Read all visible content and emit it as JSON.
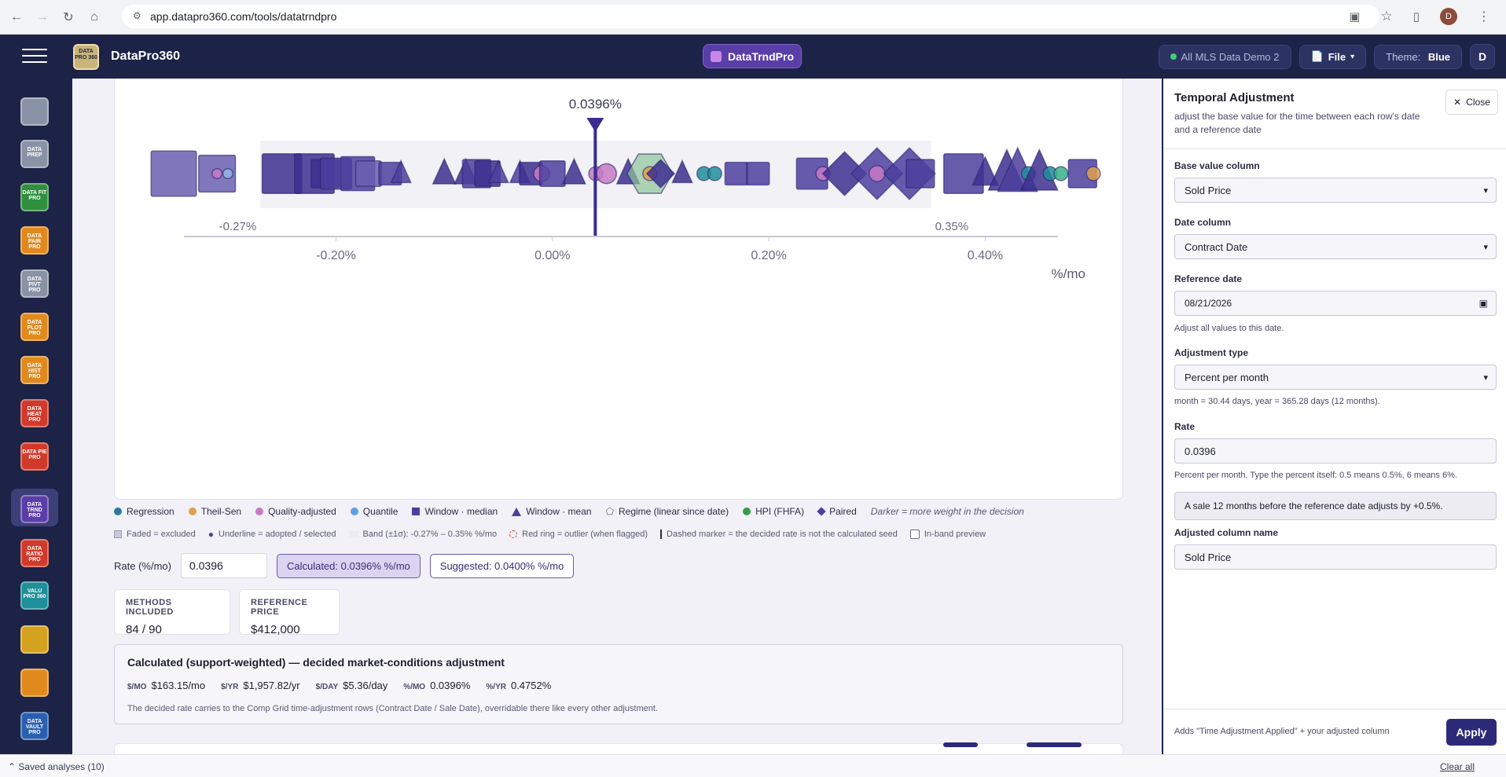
{
  "browser": {
    "url": "app.datapro360.com/tools/datatrndpro",
    "avatar_letter": "D"
  },
  "app": {
    "brand": "DataPro360",
    "logo_text": "DATA PRO 360",
    "tool_name": "DataTrndPro",
    "data_source": "All MLS Data Demo 2",
    "file_label": "File",
    "theme_label": "Theme: ",
    "theme_value": "Blue",
    "user_badge": "D"
  },
  "sidebar": {
    "items": [
      {
        "label": "",
        "color": "#8a93a6"
      },
      {
        "label": "DATA PREP",
        "color": "#8a93a6"
      },
      {
        "label": "DATA FIT PRO",
        "color": "#2f8f3f"
      },
      {
        "label": "DATA PAIR PRO",
        "color": "#e08a1e"
      },
      {
        "label": "DATA PIVT PRO",
        "color": "#8a93a6"
      },
      {
        "label": "DATA PLOT PRO",
        "color": "#e08a1e"
      },
      {
        "label": "DATA HIST PRO",
        "color": "#e08a1e"
      },
      {
        "label": "DATA HEAT PRO",
        "color": "#d13a2a"
      },
      {
        "label": "DATA PIE PRO",
        "color": "#d13a2a"
      },
      {
        "label": "DATA TRND PRO",
        "color": "#5a3ea8"
      },
      {
        "label": "DATA RATIO PRO",
        "color": "#d13a2a"
      },
      {
        "label": "VALU PRO 360",
        "color": "#1f8f9a"
      },
      {
        "label": "",
        "color": "#d4a21e"
      },
      {
        "label": "",
        "color": "#e08a1e"
      },
      {
        "label": "DATA VAULT PRO",
        "color": "#2a5fb0"
      }
    ]
  },
  "chart_data": {
    "type": "scatter",
    "xlabel": "%/mo",
    "xlim": [
      -0.39,
      0.46
    ],
    "ticks": [
      "-0.20%",
      "0.00%",
      "0.20%",
      "0.40%"
    ],
    "tick_values": [
      -0.2,
      0.0,
      0.2,
      0.4
    ],
    "decided_rate": 0.0396,
    "decided_label": "0.0396%",
    "band_low": -0.27,
    "band_high": 0.35,
    "band_low_label": "-0.27%",
    "band_high_label": "0.35%",
    "points": [
      {
        "x": -0.35,
        "shape": "square",
        "s": 1.6,
        "c": "#6a5fb0"
      },
      {
        "x": -0.31,
        "shape": "square",
        "s": 1.3,
        "c": "#6a5fb0"
      },
      {
        "x": -0.3,
        "shape": "circle",
        "s": 0.5,
        "c": "#8fb5e0"
      },
      {
        "x": -0.31,
        "shape": "circle",
        "s": 0.5,
        "c": "#c77ac4"
      },
      {
        "x": -0.25,
        "shape": "square",
        "s": 1.4,
        "c": "#3d2f8f"
      },
      {
        "x": -0.22,
        "shape": "square",
        "s": 1.4,
        "c": "#3d2f8f"
      },
      {
        "x": -0.21,
        "shape": "square",
        "s": 1.0,
        "c": "#3d2f8f"
      },
      {
        "x": -0.2,
        "shape": "square",
        "s": 1.1,
        "c": "#4c3f9e"
      },
      {
        "x": -0.18,
        "shape": "square",
        "s": 1.2,
        "c": "#4c3f9e"
      },
      {
        "x": -0.17,
        "shape": "square",
        "s": 0.9,
        "c": "#6a5fb0"
      },
      {
        "x": -0.15,
        "shape": "square",
        "s": 0.8,
        "c": "#4c3f9e"
      },
      {
        "x": -0.14,
        "shape": "triangle",
        "s": 0.7,
        "c": "#4c3f9e"
      },
      {
        "x": -0.1,
        "shape": "triangle",
        "s": 0.8,
        "c": "#3d2f8f"
      },
      {
        "x": -0.08,
        "shape": "triangle",
        "s": 0.8,
        "c": "#3d2f8f"
      },
      {
        "x": -0.07,
        "shape": "square",
        "s": 1.0,
        "c": "#4c3f9e"
      },
      {
        "x": -0.06,
        "shape": "square",
        "s": 0.9,
        "c": "#3d2f8f"
      },
      {
        "x": -0.05,
        "shape": "triangle",
        "s": 0.7,
        "c": "#4c3f9e"
      },
      {
        "x": -0.03,
        "shape": "triangle",
        "s": 0.7,
        "c": "#4c3f9e"
      },
      {
        "x": -0.02,
        "shape": "square",
        "s": 0.8,
        "c": "#3d2f8f"
      },
      {
        "x": -0.01,
        "shape": "circle",
        "s": 0.8,
        "c": "#c77ac4"
      },
      {
        "x": 0.0,
        "shape": "square",
        "s": 0.9,
        "c": "#4c3f9e"
      },
      {
        "x": 0.02,
        "shape": "triangle",
        "s": 0.8,
        "c": "#3d2f8f"
      },
      {
        "x": 0.04,
        "shape": "circle",
        "s": 0.7,
        "c": "#c77ac4"
      },
      {
        "x": 0.05,
        "shape": "circle",
        "s": 1.0,
        "c": "#c77ac4"
      },
      {
        "x": 0.07,
        "shape": "triangle",
        "s": 0.8,
        "c": "#3d2f8f"
      },
      {
        "x": 0.09,
        "shape": "hexagon",
        "s": 1.6,
        "c": "#8fc49a"
      },
      {
        "x": 0.09,
        "shape": "circle",
        "s": 0.7,
        "c": "#e0a050"
      },
      {
        "x": 0.1,
        "shape": "diamond",
        "s": 0.7,
        "c": "#3d2f8f"
      },
      {
        "x": 0.12,
        "shape": "triangle",
        "s": 0.7,
        "c": "#3d2f8f"
      },
      {
        "x": 0.14,
        "shape": "circle",
        "s": 0.7,
        "c": "#1f8f9a"
      },
      {
        "x": 0.15,
        "shape": "circle",
        "s": 0.7,
        "c": "#1f8f9a"
      },
      {
        "x": 0.17,
        "shape": "square",
        "s": 0.8,
        "c": "#4c3f9e"
      },
      {
        "x": 0.19,
        "shape": "square",
        "s": 0.8,
        "c": "#4c3f9e"
      },
      {
        "x": 0.24,
        "shape": "square",
        "s": 1.1,
        "c": "#4c3f9e"
      },
      {
        "x": 0.25,
        "shape": "circle",
        "s": 0.7,
        "c": "#c77ac4"
      },
      {
        "x": 0.27,
        "shape": "diamond",
        "s": 1.1,
        "c": "#3d2f8f"
      },
      {
        "x": 0.3,
        "shape": "diamond",
        "s": 1.3,
        "c": "#4c3f9e"
      },
      {
        "x": 0.3,
        "shape": "circle",
        "s": 0.8,
        "c": "#c77ac4"
      },
      {
        "x": 0.33,
        "shape": "diamond",
        "s": 1.3,
        "c": "#4c3f9e"
      },
      {
        "x": 0.34,
        "shape": "square",
        "s": 1.0,
        "c": "#4c3f9e"
      },
      {
        "x": 0.38,
        "shape": "square",
        "s": 1.4,
        "c": "#4c3f9e"
      },
      {
        "x": 0.4,
        "shape": "triangle",
        "s": 0.9,
        "c": "#3d2f8f"
      },
      {
        "x": 0.42,
        "shape": "triangle",
        "s": 1.3,
        "c": "#3d2f8f"
      },
      {
        "x": 0.43,
        "shape": "triangle",
        "s": 1.4,
        "c": "#4c3f9e"
      },
      {
        "x": 0.44,
        "shape": "circle",
        "s": 0.7,
        "c": "#1f8f9a"
      },
      {
        "x": 0.45,
        "shape": "triangle",
        "s": 1.3,
        "c": "#3d2f8f"
      },
      {
        "x": 0.46,
        "shape": "circle",
        "s": 0.7,
        "c": "#1f8f9a"
      },
      {
        "x": 0.47,
        "shape": "circle",
        "s": 0.7,
        "c": "#3ab08a"
      },
      {
        "x": 0.49,
        "shape": "square",
        "s": 1.0,
        "c": "#4c3f9e"
      },
      {
        "x": 0.5,
        "shape": "circle",
        "s": 0.7,
        "c": "#e0a050"
      },
      {
        "x": 0.57,
        "shape": "triangle",
        "s": 1.6,
        "c": "#6a5fb0"
      }
    ]
  },
  "legend": {
    "items": [
      {
        "label": "Regression",
        "color": "#2a7a9a",
        "shape": "circle"
      },
      {
        "label": "Theil-Sen",
        "color": "#e0a050",
        "shape": "circle"
      },
      {
        "label": "Quality-adjusted",
        "color": "#c77ac4",
        "shape": "circle"
      },
      {
        "label": "Quantile",
        "color": "#5aa0e0",
        "shape": "circle"
      },
      {
        "label": "Window · median",
        "color": "#4c3f9e",
        "shape": "square"
      },
      {
        "label": "Window · mean",
        "color": "#4c3f9e",
        "shape": "triangle"
      },
      {
        "label": "Regime (linear since date)",
        "color": "#6a6a80",
        "shape": "pentagon"
      },
      {
        "label": "HPI (FHFA)",
        "color": "#3a9a4a",
        "shape": "circle"
      },
      {
        "label": "Paired",
        "color": "#4c3f9e",
        "shape": "diamond"
      }
    ],
    "note": "Darker = more weight in the decision",
    "row2": {
      "faded": "Faded = excluded",
      "underline": "Underline = adopted / selected",
      "band": "Band (±1σ): -0.27% – 0.35% %/mo",
      "red_ring": "Red ring = outlier (when flagged)",
      "dashed": "Dashed marker = the decided rate is not the calculated seed",
      "inband": "In-band preview"
    }
  },
  "rate": {
    "label": "Rate (%/mo)",
    "value": "0.0396",
    "calculated": "Calculated: 0.0396% %/mo",
    "suggested": "Suggested: 0.0400% %/mo"
  },
  "stats": {
    "methods_label": "METHODS INCLUDED",
    "methods_value": "84 / 90",
    "ref_label": "REFERENCE PRICE",
    "ref_value": "$412,000"
  },
  "summary": {
    "title": "Calculated (support-weighted) — decided market-conditions adjustment",
    "items": [
      {
        "label": "$/MO",
        "value": "$163.15/mo"
      },
      {
        "label": "$/YR",
        "value": "$1,957.82/yr"
      },
      {
        "label": "$/DAY",
        "value": "$5.36/day"
      },
      {
        "label": "%/MO",
        "value": "0.0396%"
      },
      {
        "label": "%/YR",
        "value": "0.4752%"
      }
    ],
    "footer": "The decided rate carries to the Comp Grid time-adjustment rows (Contract Date / Sale Date), overridable there like every other adjustment."
  },
  "panel": {
    "title": "Temporal Adjustment",
    "subtitle": "adjust the base value for the time between each row's date and a reference date",
    "close": "Close",
    "base_label": "Base value column",
    "base_value": "Sold Price",
    "date_label": "Date column",
    "date_value": "Contract Date",
    "ref_label": "Reference date",
    "ref_value": "08/21/2026",
    "ref_help": "Adjust all values to this date.",
    "type_label": "Adjustment type",
    "type_value": "Percent per month",
    "type_help": "month = 30.44 days, year = 365.28 days (12 months).",
    "rate_label": "Rate",
    "rate_value": "0.0396",
    "rate_help": "Percent per month. Type the percent itself: 0.5 means 0.5%, 6 means 6%.",
    "example": "A sale 12 months before the reference date adjusts by +0.5%.",
    "name_label": "Adjusted column name",
    "name_value": "Sold Price",
    "footer": "Adds \"Time Adjustment Applied\" + your adjusted column",
    "apply": "Apply"
  },
  "status": {
    "saved": "Saved analyses (10)",
    "clear": "Clear all"
  }
}
